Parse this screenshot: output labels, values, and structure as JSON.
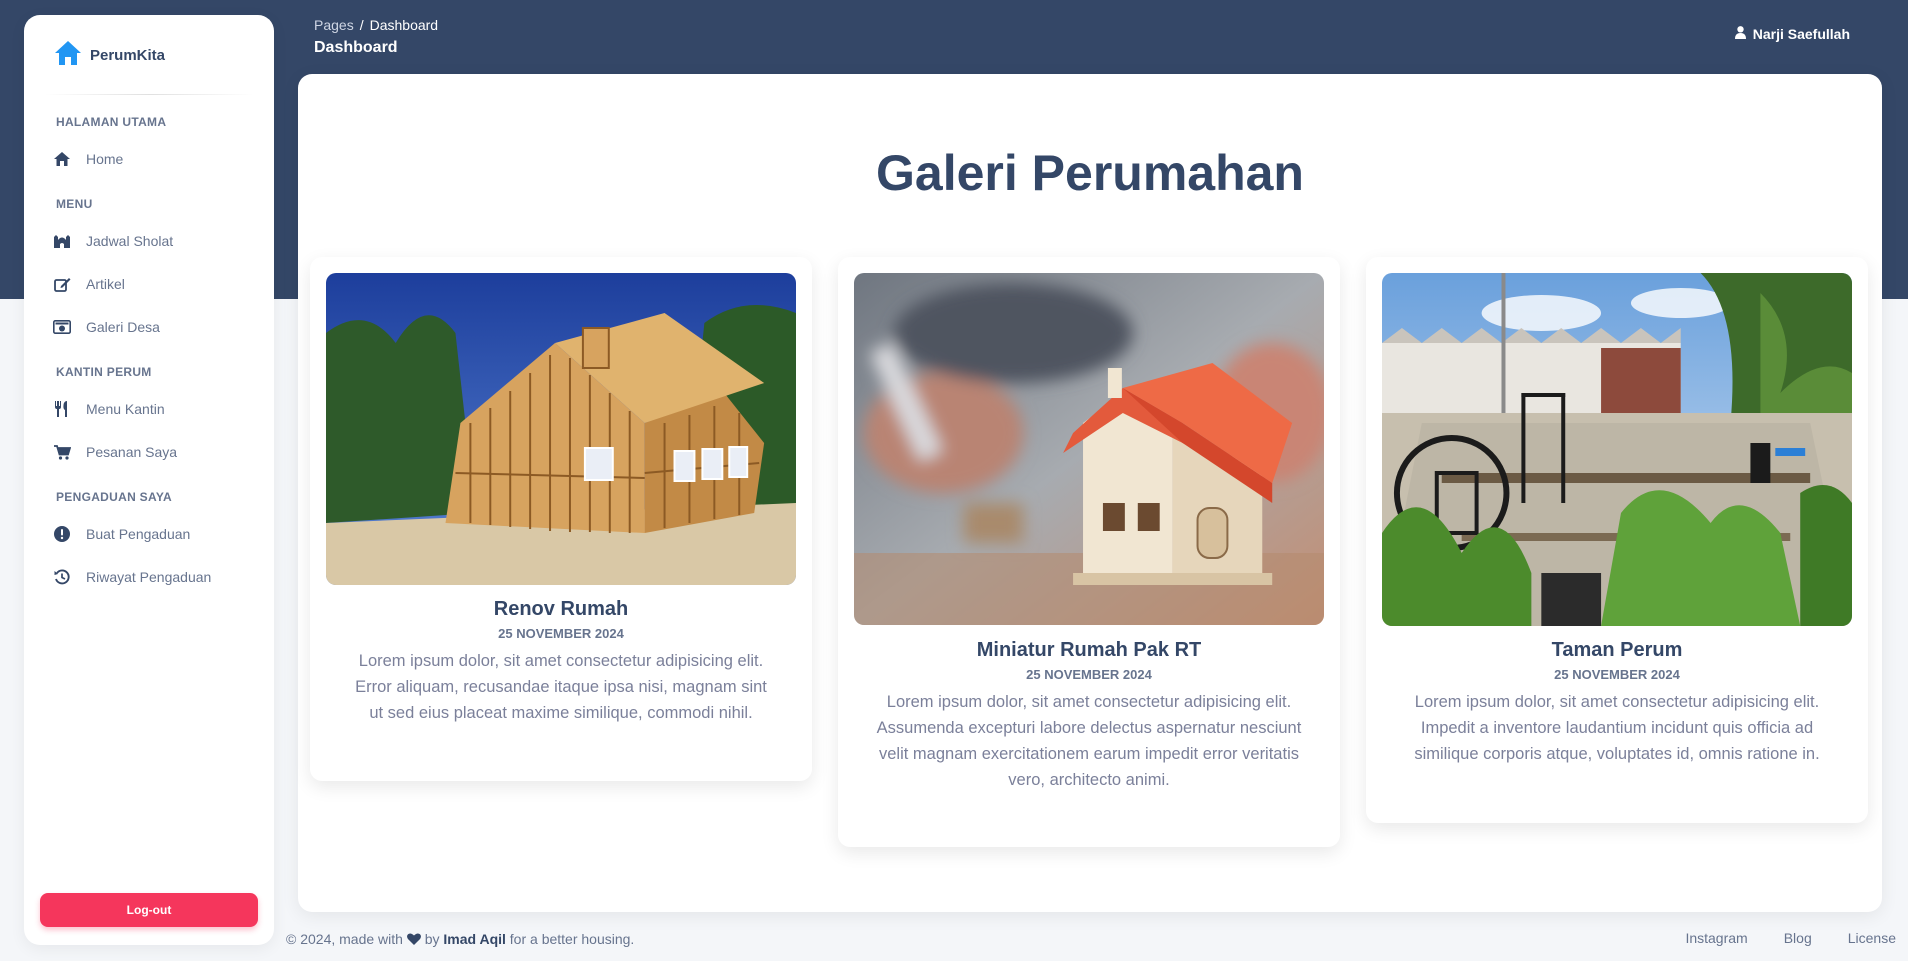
{
  "brand": {
    "name": "PerumKita",
    "icon": "house-icon"
  },
  "sidebar": {
    "sections": [
      {
        "title": "HALAMAN UTAMA"
      },
      {
        "title": "MENU"
      },
      {
        "title": "KANTIN PERUM"
      },
      {
        "title": "PENGADUAN SAYA"
      }
    ],
    "items": [
      {
        "label": "Home",
        "icon": "home-icon"
      },
      {
        "label": "Jadwal Sholat",
        "icon": "mosque-icon"
      },
      {
        "label": "Artikel",
        "icon": "edit-icon"
      },
      {
        "label": "Galeri Desa",
        "icon": "camera-icon"
      },
      {
        "label": "Menu Kantin",
        "icon": "utensils-icon"
      },
      {
        "label": "Pesanan Saya",
        "icon": "cart-icon"
      },
      {
        "label": "Buat Pengaduan",
        "icon": "exclamation-icon"
      },
      {
        "label": "Riwayat Pengaduan",
        "icon": "history-icon"
      }
    ],
    "logout_label": "Log-out"
  },
  "header": {
    "breadcrumb_root": "Pages",
    "breadcrumb_separator": "/",
    "breadcrumb_current": "Dashboard",
    "page_title": "Dashboard",
    "user_name": "Narji Saefullah"
  },
  "main": {
    "title": "Galeri Perumahan",
    "cards": [
      {
        "title": "Renov Rumah",
        "date": "25 NOVEMBER 2024",
        "text": "Lorem ipsum dolor, sit amet consectetur adipisicing elit. Error aliquam, recusandae itaque ipsa nisi, magnam sint ut sed eius placeat maxime similique, commodi nihil."
      },
      {
        "title": "Miniatur Rumah Pak RT",
        "date": "25 NOVEMBER 2024",
        "text": "Lorem ipsum dolor, sit amet consectetur adipisicing elit. Assumenda excepturi labore delectus aspernatur nesciunt velit magnam exercitationem earum impedit error veritatis vero, architecto animi."
      },
      {
        "title": "Taman Perum",
        "date": "25 NOVEMBER 2024",
        "text": "Lorem ipsum dolor, sit amet consectetur adipisicing elit. Impedit a inventore laudantium incidunt quis officia ad similique corporis atque, voluptates id, omnis ratione in."
      }
    ]
  },
  "footer": {
    "copy_prefix": "© 2024, made with",
    "copy_by": "by",
    "author": "Imad Aqil",
    "copy_suffix": "for a better housing.",
    "links": [
      "Instagram",
      "Blog",
      "License"
    ]
  },
  "colors": {
    "primary": "#344767",
    "danger": "#f5365c",
    "brand_icon": "#2196f3"
  }
}
